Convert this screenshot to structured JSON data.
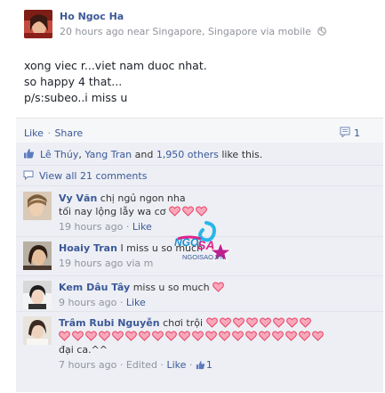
{
  "post": {
    "author": "Ho Ngoc Ha",
    "meta": "20 hours ago near Singapore, Singapore via mobile",
    "lines": [
      "xong viec r...viet nam duoc nhat.",
      "so happy 4 that...",
      "p/s:subeo..i miss u"
    ]
  },
  "actions": {
    "like": "Like",
    "dot": "·",
    "share": "Share",
    "comment_count": "1"
  },
  "likes": {
    "name1": "Lê Thúy",
    "sep": ", ",
    "name2": "Yang Tran",
    "and": " and ",
    "others": "1,950 others",
    "suffix": " like this."
  },
  "view_all": "View all 21 comments",
  "comments": [
    {
      "author": "Vy Văn",
      "text": "chị ngủ ngon nha",
      "text2": "tối nay lộng lẫy wa cơ",
      "hearts": 3,
      "time": "19 hours ago",
      "like": "Like"
    },
    {
      "author": "Hoaiy Tran",
      "text": "I miss u so much",
      "time": "19 hours ago via m",
      "like": ""
    },
    {
      "author": "Kem Dâu Tây",
      "text": "miss u so much",
      "hearts": 1,
      "time": "9 hours ago",
      "like": "Like"
    },
    {
      "author": "Trâm Rubi Nguyễn",
      "text": "chơi trội",
      "hearts_line1": 8,
      "hearts_line2": 20,
      "text2": "đại ca.^^",
      "time": "7 hours ago",
      "edited": "Edited",
      "like": "Like",
      "like_count": "1"
    }
  ],
  "watermark": {
    "text": "NGOISAO.VN"
  },
  "colors": {
    "link": "#3b5998",
    "meta": "#90949c",
    "heart_fill": "#f9a8ba",
    "heart_stroke": "#e8466a",
    "feedback_bg": "#edeff4"
  },
  "icons": [
    "globe-icon",
    "comment-icon",
    "thumbs-up-icon",
    "speech-bubble-icon",
    "heart-icon"
  ]
}
